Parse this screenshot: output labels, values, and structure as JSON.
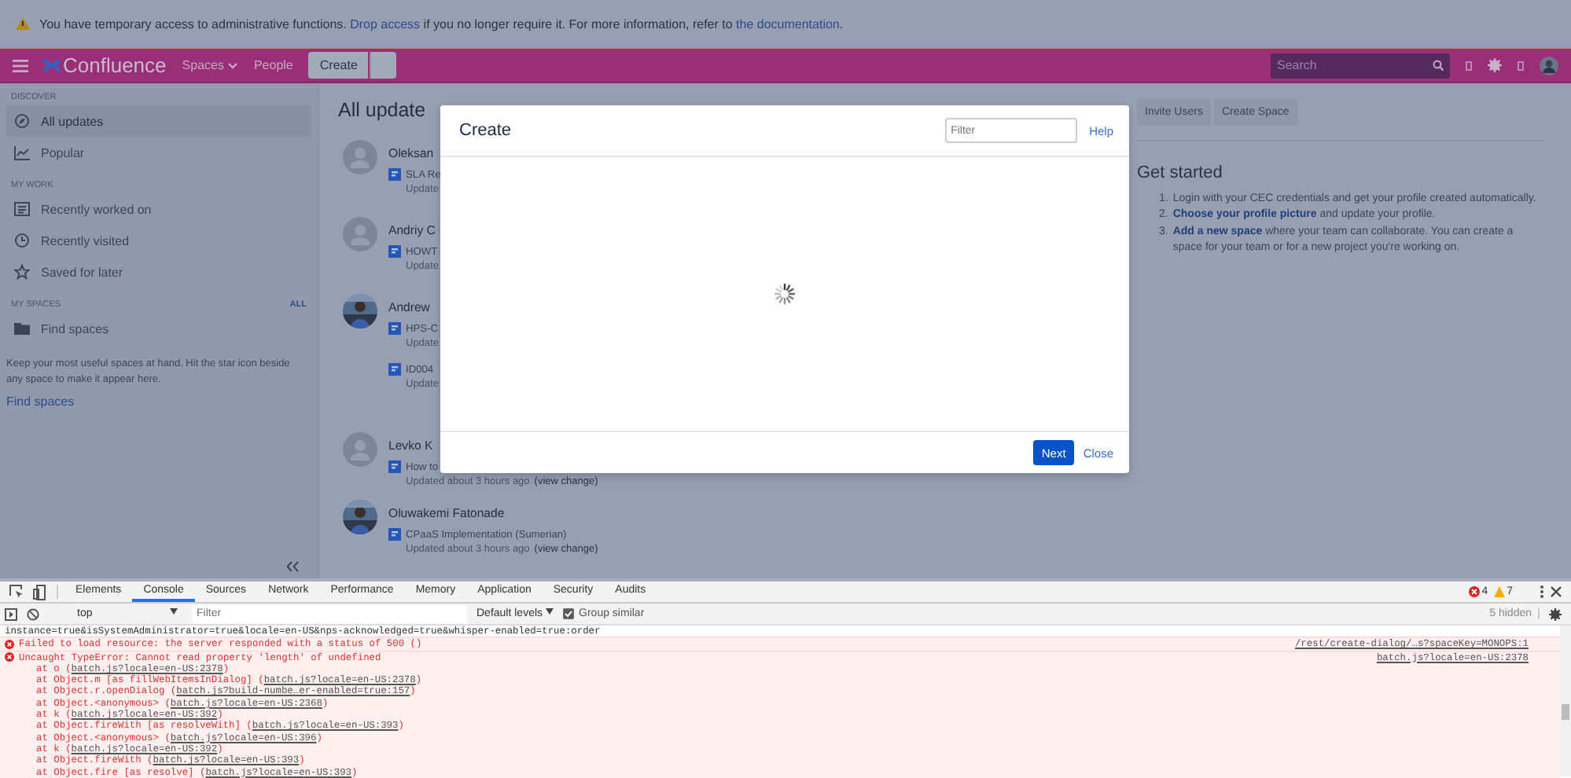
{
  "banner": {
    "text": "You have temporary access to administrative functions.",
    "link": "Drop access",
    "text2": "if you no longer require it. For more information, refer to",
    "link2": "the documentation",
    "end": "."
  },
  "header": {
    "logo": "Confluence",
    "nav": [
      {
        "label": "Spaces",
        "dropdown": true
      },
      {
        "label": "People",
        "dropdown": false
      }
    ],
    "create": "Create",
    "search": {
      "placeholder": "Search"
    }
  },
  "sidebar": {
    "sections": [
      {
        "title": "DISCOVER",
        "items": [
          {
            "label": "All updates",
            "kind": "compass",
            "selected": true
          },
          {
            "label": "Popular",
            "kind": "chart",
            "selected": false
          }
        ]
      },
      {
        "title": "MY WORK",
        "items": [
          {
            "label": "Recently worked on",
            "kind": "doc",
            "selected": false
          },
          {
            "label": "Recently visited",
            "kind": "clock",
            "selected": false
          },
          {
            "label": "Saved for later",
            "kind": "star",
            "selected": false
          }
        ]
      },
      {
        "title": "MY SPACES",
        "action": "ALL",
        "items": [
          {
            "label": "Find spaces",
            "kind": "folder",
            "selected": false
          }
        ]
      }
    ],
    "note": "Keep your most useful spaces at hand. Hit the star icon beside any space to make it appear here.",
    "link": "Find spaces"
  },
  "main": {
    "heading": "All update",
    "feed": [
      {
        "name": "Oleksan",
        "kind": "default",
        "pages": [
          {
            "title": "SLA Re",
            "meta": "Update"
          }
        ]
      },
      {
        "name": "Andriy C",
        "kind": "default",
        "pages": [
          {
            "title": "HOWT",
            "meta": "Update"
          }
        ]
      },
      {
        "name": "Andrew",
        "kind": "picture",
        "pages": [
          {
            "title": "HPS-C",
            "meta": "Update"
          },
          {
            "title": "ID004",
            "meta": "Update"
          }
        ]
      },
      {
        "name": "Levko K",
        "kind": "default",
        "pages": [
          {
            "title": "How to",
            "meta": "Updated about 3 hours ago",
            "link": "(view change)"
          }
        ]
      },
      {
        "name": "Oluwakemi Fatonade",
        "kind": "picture",
        "pages": [
          {
            "title": "CPaaS Implementation (Sumerian)",
            "meta": "Updated about 3 hours ago",
            "link": "(view change)"
          }
        ]
      }
    ]
  },
  "right_panel": {
    "buttons": [
      "Invite Users",
      "Create Space"
    ],
    "title": "Get started",
    "steps": [
      {
        "num": "1.",
        "text": "Login with your CEC credentials and get your profile created automatically."
      },
      {
        "num": "2.",
        "link": "Choose your profile picture",
        "text": "and update your profile."
      },
      {
        "num": "3.",
        "link": "Add a new space",
        "text": "where your team can collaborate. You can create a space for your team or for a new project you're working on."
      }
    ]
  },
  "dialog": {
    "title": "Create",
    "filter": {
      "placeholder": "Filter"
    },
    "help": "Help",
    "loading": true,
    "next": "Next",
    "close": "Close"
  },
  "devtools": {
    "tabs": [
      {
        "label": "Elements",
        "selected": false
      },
      {
        "label": "Console",
        "selected": true
      },
      {
        "label": "Sources",
        "selected": false
      },
      {
        "label": "Network",
        "selected": false
      },
      {
        "label": "Performance",
        "selected": false
      },
      {
        "label": "Memory",
        "selected": false
      },
      {
        "label": "Application",
        "selected": false
      },
      {
        "label": "Security",
        "selected": false
      },
      {
        "label": "Audits",
        "selected": false
      }
    ],
    "errors": "4",
    "warnings": "7",
    "context": "top",
    "filter": {
      "placeholder": "Filter"
    },
    "levels": "Default levels",
    "group_similar": {
      "label": "Group similar",
      "checked": true
    },
    "hidden": "5 hidden",
    "console": [
      {
        "kind": "log",
        "text": "instance=true&isSystemAdministrator=true&locale=en-US&nps-acknowledged=true&whisper-enabled=true:order"
      },
      {
        "kind": "error",
        "text": "Failed to load resource: the server responded with a status of 500 ()",
        "source": "/rest/create-dialog/…s?spaceKey=MONOPS:1"
      },
      {
        "kind": "error",
        "text": "Uncaught TypeError: Cannot read property 'length' of undefined",
        "source": "batch.js?locale=en-US:2378",
        "stack": [
          {
            "pre": "at o (",
            "link": "batch.js?locale=en-US:2378",
            "post": ")"
          },
          {
            "pre": "at Object.m [as fillWebItemsInDialog] (",
            "link": "batch.js?locale=en-US:2378",
            "post": ")"
          },
          {
            "pre": "at Object.r.openDialog (",
            "link": "batch.js?build-numbe…er-enabled=true:157",
            "post": ")"
          },
          {
            "pre": "at Object.<anonymous> (",
            "link": "batch.js?locale=en-US:2368",
            "post": ")"
          },
          {
            "pre": "at k (",
            "link": "batch.js?locale=en-US:392",
            "post": ")"
          },
          {
            "pre": "at Object.fireWith [as resolveWith] (",
            "link": "batch.js?locale=en-US:393",
            "post": ")"
          },
          {
            "pre": "at Object.<anonymous> (",
            "link": "batch.js?locale=en-US:396",
            "post": ")"
          },
          {
            "pre": "at k (",
            "link": "batch.js?locale=en-US:392",
            "post": ")"
          },
          {
            "pre": "at Object.fireWith (",
            "link": "batch.js?locale=en-US:393",
            "post": ")"
          },
          {
            "pre": "at Object.fire [as resolve] (",
            "link": "batch.js?locale=en-US:393",
            "post": ")"
          }
        ]
      }
    ]
  }
}
